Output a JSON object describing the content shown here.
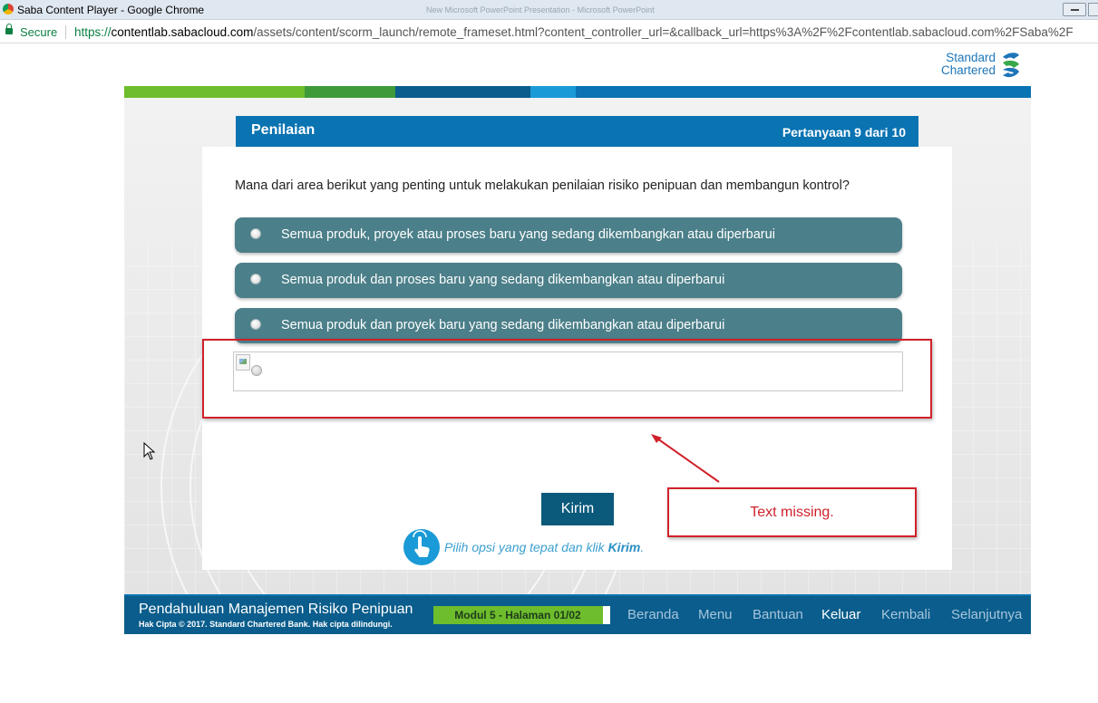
{
  "window": {
    "title": "Saba Content Player - Google Chrome",
    "ghost_title": "New Microsoft PowerPoint Presentation - Microsoft PowerPoint"
  },
  "address_bar": {
    "secure_label": "Secure",
    "url": "https://contentlab.sabacloud.com/assets/content/scorm_launch/remote_frameset.html?content_controller_url=&callback_url=https%3A%2F%2Fcontentlab.sabacloud.com%2FSaba%2F"
  },
  "logo": {
    "line1": "Standard",
    "line2": "Chartered"
  },
  "topbar_colors": [
    "#6ebd2c",
    "#3f9b3a",
    "#0a5d8c",
    "#1a9ad6",
    "#0a73b2"
  ],
  "panel": {
    "title": "Penilaian",
    "counter": "Pertanyaan  9  dari 10"
  },
  "question": "Mana dari area berikut yang penting untuk melakukan penilaian risiko penipuan dan membangun kontrol?",
  "options": [
    {
      "label": "Semua produk, proyek atau proses baru yang sedang dikembangkan atau diperbarui"
    },
    {
      "label": "Semua produk dan proses baru yang sedang dikembangkan atau diperbarui"
    },
    {
      "label": "Semua produk dan proyek baru yang sedang dikembangkan atau diperbarui"
    }
  ],
  "annotation": {
    "text": "Text missing.",
    "color": "#d0212a"
  },
  "submit_label": "Kirim",
  "hint": {
    "prefix": "Pilih opsi yang tepat dan klik ",
    "emphasis": "Kirim",
    "suffix": "."
  },
  "footer": {
    "course_title": "Pendahuluan Manajemen Risiko Penipuan",
    "copyright": "Hak Cipta © 2017. Standard Chartered Bank. Hak cipta dilindungi.",
    "progress_label": "Modul 5 - Halaman 01/02",
    "progress_fraction": 0.96,
    "nav": [
      {
        "label": "Beranda",
        "active": false
      },
      {
        "label": "Menu",
        "active": false
      },
      {
        "label": "Bantuan",
        "active": false
      },
      {
        "label": "Keluar",
        "active": true
      },
      {
        "label": "Kembali",
        "active": false
      },
      {
        "label": "Selanjutnya",
        "active": false
      }
    ]
  }
}
